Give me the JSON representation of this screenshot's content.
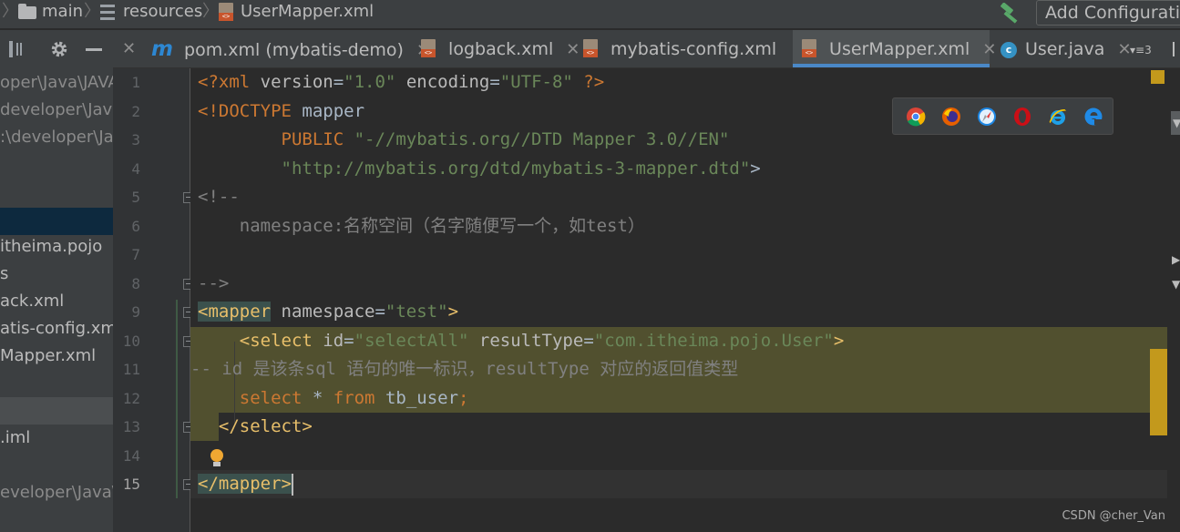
{
  "breadcrumb": {
    "main": "main",
    "resources": "resources",
    "file": "UserMapper.xml"
  },
  "toolbar": {
    "add_configuration": "Add Configuration..."
  },
  "sidebar": {
    "items": [
      {
        "label": "oper\\Java\\JAVAI",
        "dim": true
      },
      {
        "label": "developer\\Java\\",
        "dim": true
      },
      {
        "label": ":\\developer\\Java\\",
        "dim": true
      },
      {
        "label": "itheima.pojo",
        "dim": false
      },
      {
        "label": "s",
        "dim": false
      },
      {
        "label": "ack.xml",
        "dim": false
      },
      {
        "label": "atis-config.xml",
        "dim": false
      },
      {
        "label": "Mapper.xml",
        "dim": false
      },
      {
        "label": ".iml",
        "dim": false
      },
      {
        "label": "eveloper\\Java\\JA",
        "dim": true
      }
    ]
  },
  "tabs": [
    {
      "label": "pom.xml (mybatis-demo)",
      "icon": "maven-icon",
      "active": false
    },
    {
      "label": "logback.xml",
      "icon": "xml-file-icon",
      "active": false
    },
    {
      "label": "mybatis-config.xml",
      "icon": "xml-file-icon",
      "active": false
    },
    {
      "label": "UserMapper.xml",
      "icon": "xml-file-icon",
      "active": true
    },
    {
      "label": "User.java",
      "icon": "java-class-icon",
      "active": false
    }
  ],
  "tab_overflow": {
    "count": "3"
  },
  "line_numbers": [
    "1",
    "2",
    "3",
    "4",
    "5",
    "6",
    "7",
    "8",
    "9",
    "10",
    "11",
    "12",
    "13",
    "14",
    "15"
  ],
  "code": {
    "l1": {
      "a": "<?xml ",
      "b": "version",
      "c": "=",
      "d": "\"1.0\"",
      "e": " encoding",
      "f": "=",
      "g": "\"UTF-8\"",
      "h": " ?>"
    },
    "l2": {
      "a": "<!DOCTYPE ",
      "b": "mapper"
    },
    "l3": {
      "a": "        PUBLIC ",
      "b": "\"-//mybatis.org//DTD Mapper 3.0//EN\""
    },
    "l4": {
      "a": "        ",
      "b": "\"http://mybatis.org/dtd/mybatis-3-mapper.dtd\"",
      "c": ">"
    },
    "l5": {
      "a": "<!--"
    },
    "l6": {
      "a": "    namespace:名称空间（名字随便写一个，如test）"
    },
    "l8": {
      "a": "-->"
    },
    "l9": {
      "a": "<mapper",
      "b": " namespace",
      "c": "=",
      "d": "\"test\"",
      "e": ">"
    },
    "l10": {
      "a": "    ",
      "b": "<select ",
      "c": "id",
      "d": "=",
      "e": "\"selectAll\"",
      "f": " resultType",
      "g": "=",
      "h": "\"com.itheima.pojo.User\"",
      "i": ">"
    },
    "l11": {
      "a": "-- id 是该条sql 语句的唯一标识，resultType 对应的返回值类型"
    },
    "l12": {
      "a": "    ",
      "b": "select",
      "c": " * ",
      "d": "from",
      "e": " tb_user",
      "f": ";"
    },
    "l13": {
      "a": "  ",
      "b": "</select>"
    },
    "l15": {
      "a": "</mapper>"
    }
  },
  "browsers": [
    "chrome-icon",
    "firefox-icon",
    "safari-icon",
    "opera-icon",
    "ie-icon",
    "edge-icon"
  ],
  "watermark": "CSDN @cher_Van"
}
